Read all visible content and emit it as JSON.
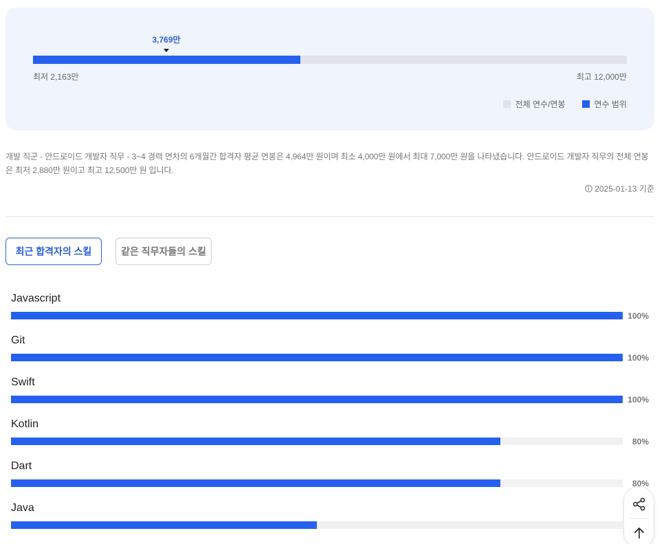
{
  "salary": {
    "marker_label": "3,769만",
    "range_fill": 0.45,
    "min_label": "최저 2,163만",
    "max_label": "최고 12,000만",
    "legend": {
      "total_label": "전체 연수/연봉",
      "range_label": "연수 범위"
    },
    "colors": {
      "track": "#e1e2ec",
      "fill": "#2560ee"
    }
  },
  "description": "개발 직군 - 안드로이드 개발자 직무 - 3~4 경력 연차의 6개월간 합격자 평균 연봉은 4,964만 원이며 최소 4,000만 원에서 최대 7,000만 원을 나타냈습니다. 안드로이드 개발자 직무의 전체 연봉은 최저 2,880만 원이고 최고 12,500만 원 입니다.",
  "basis_date": "2025-01-13 기준",
  "tabs": [
    {
      "label": "최근 합격자의 스킬",
      "active": true
    },
    {
      "label": "같은 직무자들의 스킬",
      "active": false
    }
  ],
  "skills": [
    {
      "name": "Javascript",
      "percent_label": "100%",
      "value": 100
    },
    {
      "name": "Git",
      "percent_label": "100%",
      "value": 100
    },
    {
      "name": "Swift",
      "percent_label": "100%",
      "value": 100
    },
    {
      "name": "Kotlin",
      "percent_label": "80%",
      "value": 80
    },
    {
      "name": "Dart",
      "percent_label": "80%",
      "value": 80
    },
    {
      "name": "Java",
      "percent_label": "",
      "value": 50
    }
  ],
  "float_buttons": [
    {
      "icon": "share-icon"
    },
    {
      "icon": "arrow-up-icon"
    }
  ],
  "accent_color": "#2560ee"
}
